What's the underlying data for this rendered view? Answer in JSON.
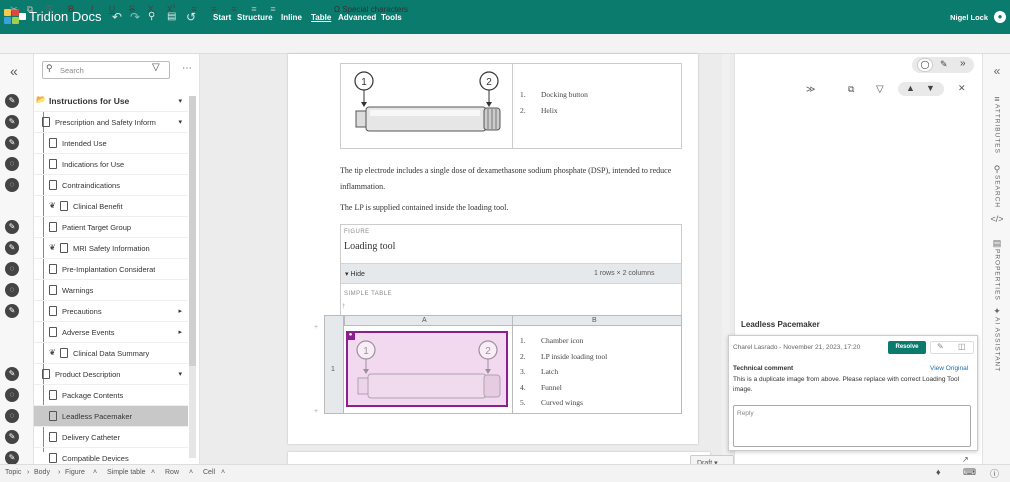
{
  "app": {
    "title": "Tridion Docs",
    "user": "Nigel Lock"
  },
  "menu": [
    {
      "label": "Start",
      "active": false
    },
    {
      "label": "Structure",
      "active": false
    },
    {
      "label": "Inline",
      "active": false
    },
    {
      "label": "Table",
      "active": true
    },
    {
      "label": "Advanced",
      "active": false
    },
    {
      "label": "Tools",
      "active": false
    }
  ],
  "toolbar": {
    "special_characters": "Special characters"
  },
  "sidebar": {
    "search_placeholder": "Search",
    "items": [
      {
        "label": "Instructions for Use",
        "level": 0,
        "bold": true,
        "arrow": "down",
        "status": "edit-icon"
      },
      {
        "label": "Prescription and Safety Inform",
        "level": 1,
        "arrow": "down",
        "status": "edit-icon"
      },
      {
        "label": "Intended Use",
        "level": 2,
        "status": "edit-icon"
      },
      {
        "label": "Indications for Use",
        "level": 2,
        "status": "comment-icon"
      },
      {
        "label": "Contraindications",
        "level": 2,
        "status": "comment-icon"
      },
      {
        "label": "Clinical Benefit",
        "level": 2,
        "status": "",
        "shared": true
      },
      {
        "label": "Patient Target Group",
        "level": 2,
        "status": "edit-icon"
      },
      {
        "label": "MRI Safety Information",
        "level": 2,
        "status": "edit-icon",
        "shared": true
      },
      {
        "label": "Pre-Implantation Considerat",
        "level": 2,
        "status": "comment-icon"
      },
      {
        "label": "Warnings",
        "level": 2,
        "status": "comment-icon"
      },
      {
        "label": "Precautions",
        "level": 2,
        "arrow": "right",
        "status": "edit-icon"
      },
      {
        "label": "Adverse Events",
        "level": 2,
        "arrow": "right",
        "status": ""
      },
      {
        "label": "Clinical Data Summary",
        "level": 2,
        "status": "",
        "shared": true
      },
      {
        "label": "Product Description",
        "level": 1,
        "arrow": "down",
        "status": "edit-icon"
      },
      {
        "label": "Package Contents",
        "level": 2,
        "status": "comment-icon"
      },
      {
        "label": "Leadless Pacemaker",
        "level": 2,
        "status": "comment-icon",
        "selected": true
      },
      {
        "label": "Delivery Catheter",
        "level": 2,
        "status": "edit-icon"
      },
      {
        "label": "Compatible Devices",
        "level": 2,
        "status": "edit-icon"
      }
    ]
  },
  "editor": {
    "top_list": [
      "Docking button",
      "Helix"
    ],
    "top_list_nums": [
      "1.",
      "2."
    ],
    "para1": "The tip electrode includes a single dose of dexamethasone sodium phosphate (DSP), intended to reduce inflammation.",
    "para2": "The LP is supplied contained inside the loading tool.",
    "figure_tag": "FIGURE",
    "figure_title": "Loading tool",
    "hide_label": "Hide",
    "table_info": "1 rows × 2 columns",
    "simple_table_tag": "SIMPLE TABLE",
    "col_a": "A",
    "col_b": "B",
    "row_num": "1",
    "callouts": [
      "1",
      "2"
    ],
    "table_list": [
      "Chamber icon",
      "LP inside loading tool",
      "Latch",
      "Funnel",
      "Curved wings"
    ],
    "table_list_nums": [
      "1.",
      "2.",
      "3.",
      "4.",
      "5."
    ],
    "draft": "Draft"
  },
  "comments": {
    "section_title": "Leadless Pacemaker",
    "author_date": "Charel Lasrado - November 21, 2023, 17:20",
    "resolve": "Resolve",
    "type": "Technical comment",
    "view_original": "View Original",
    "text": "This is a duplicate image from above. Please replace with correct Loading Tool image.",
    "reply_placeholder": "Reply"
  },
  "rail": [
    "ATTRIBUTES",
    "SEARCH",
    "PROPERTIES",
    "AI ASSISTANT"
  ],
  "breadcrumb": [
    "Topic",
    "Body",
    "Figure",
    "Simple table",
    "Row",
    "Cell"
  ],
  "colors": {
    "brand": "#0b7b6e",
    "selection": "#c8c8c8",
    "comment_highlight": "#f3d9f0"
  }
}
